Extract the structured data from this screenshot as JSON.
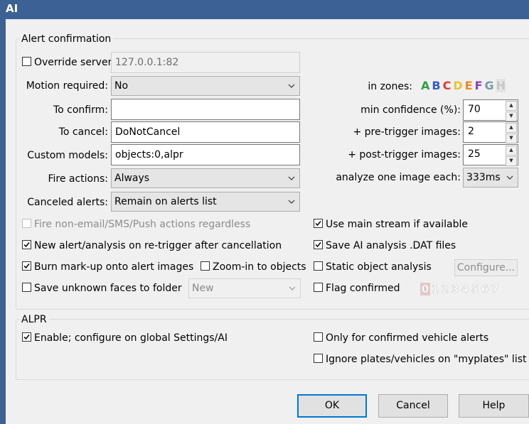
{
  "window": {
    "title": "AI"
  },
  "alert_confirmation": {
    "group_title": "Alert confirmation",
    "override_server": {
      "label": "Override server:",
      "checked": false,
      "value": "127.0.0.1:82"
    },
    "motion_required": {
      "label": "Motion required:",
      "value": "No"
    },
    "to_confirm": {
      "label": "To confirm:",
      "value": ""
    },
    "to_cancel": {
      "label": "To cancel:",
      "value": "DoNotCancel"
    },
    "custom_models": {
      "label": "Custom models:",
      "value": "objects:0,alpr"
    },
    "fire_actions": {
      "label": "Fire actions:",
      "value": "Always"
    },
    "canceled_alerts": {
      "label": "Canceled alerts:",
      "value": "Remain on alerts list"
    },
    "in_zones": {
      "label": "in zones:",
      "letters": [
        "A",
        "B",
        "C",
        "D",
        "E",
        "F",
        "G",
        "H"
      ],
      "colors": [
        "#2ea043",
        "#2f5bd8",
        "#e03a2e",
        "#e8c52a",
        "#ef8a1d",
        "#8b3fb8",
        "#7a9aa8",
        "#c6c6c6"
      ]
    },
    "min_confidence": {
      "label": "min confidence (%):",
      "value": "70"
    },
    "pre_trigger": {
      "label": "+ pre-trigger images:",
      "value": "2"
    },
    "post_trigger": {
      "label": "+ post-trigger images:",
      "value": "25"
    },
    "analyze_each": {
      "label": "analyze one image each:",
      "value": "333ms"
    },
    "checks": {
      "fire_non_email": {
        "label": "Fire non-email/SMS/Push actions regardless",
        "checked": false,
        "disabled": true
      },
      "new_alert": {
        "label": "New alert/analysis on re-trigger after cancellation",
        "checked": true
      },
      "burn_markup": {
        "label": "Burn mark-up onto alert images",
        "checked": true
      },
      "zoom_in": {
        "label": "Zoom-in to objects",
        "checked": false
      },
      "save_unknown": {
        "label": "Save unknown faces to folder",
        "checked": false
      },
      "use_main_stream": {
        "label": "Use main stream if available",
        "checked": true
      },
      "save_dat": {
        "label": "Save AI analysis .DAT files",
        "checked": true
      },
      "static_object": {
        "label": "Static object analysis",
        "checked": false
      },
      "flag_confirmed": {
        "label": "Flag confirmed",
        "checked": false
      }
    },
    "save_unknown_folder": {
      "value": "New"
    },
    "configure_button": "Configure...",
    "flag_digits": [
      "0",
      "1",
      "2",
      "3",
      "4",
      "5",
      "6",
      "7"
    ]
  },
  "alpr": {
    "group_title": "ALPR",
    "enable": {
      "label": "Enable; configure on global Settings/AI",
      "checked": true
    },
    "only_confirmed": {
      "label": "Only for confirmed vehicle alerts",
      "checked": false
    },
    "ignore_plates": {
      "label": "Ignore plates/vehicles on \"myplates\" list",
      "checked": false
    }
  },
  "buttons": {
    "ok": "OK",
    "cancel": "Cancel",
    "help": "Help"
  }
}
